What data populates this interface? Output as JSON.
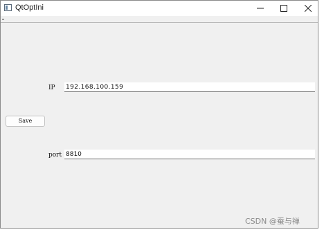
{
  "window": {
    "title": "QtOptIni"
  },
  "form": {
    "ip_label": "IP",
    "ip_value": "192.168.100.159",
    "port_label": "port",
    "port_value": "8810",
    "save_label": "Save"
  },
  "watermark": "CSDN @蚕与禅",
  "icons": {
    "app": "app-window-icon",
    "minimize": "minimize-icon",
    "maximize": "maximize-icon",
    "close": "close-icon"
  },
  "colors": {
    "window_bg": "#f0f0f0",
    "titlebar_bg": "#ffffff",
    "input_bg": "#ffffff"
  }
}
